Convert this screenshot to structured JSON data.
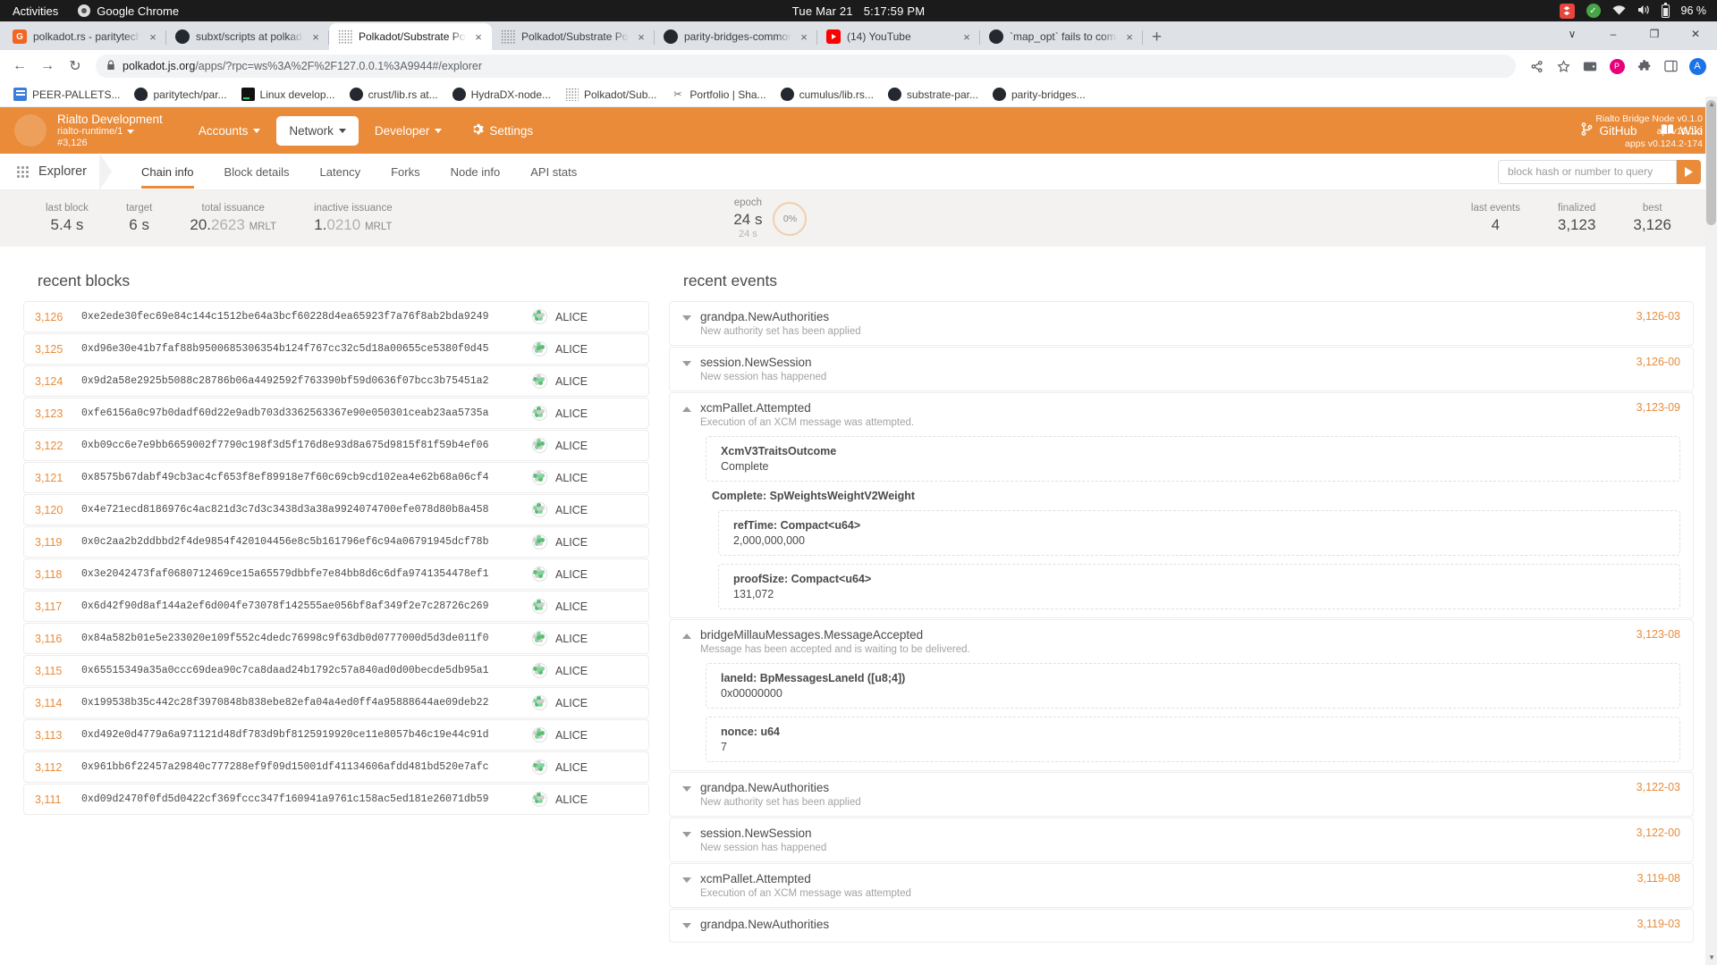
{
  "os_bar": {
    "activities": "Activities",
    "app_name": "Google Chrome",
    "clock_date": "Tue Mar 21",
    "clock_time": "5:17:59 PM",
    "battery_percent": "96 %",
    "tray_icons": [
      "dropbox-icon",
      "check-circle-icon",
      "wifi-icon",
      "volume-icon",
      "battery-icon"
    ]
  },
  "browser": {
    "tabs": [
      {
        "title": "polkadot.rs - paritytech/p",
        "favicon": "gitlab-icon",
        "active": false
      },
      {
        "title": "subxt/scripts at polkadot",
        "favicon": "github-icon",
        "active": false
      },
      {
        "title": "Polkadot/Substrate Porta",
        "favicon": "polkadot-icon",
        "active": true
      },
      {
        "title": "Polkadot/Substrate Porta",
        "favicon": "polkadot-icon",
        "active": false
      },
      {
        "title": "parity-bridges-common/x",
        "favicon": "github-icon",
        "active": false
      },
      {
        "title": "(14) YouTube",
        "favicon": "youtube-icon",
        "active": false
      },
      {
        "title": "`map_opt` fails to compil",
        "favicon": "github-icon",
        "active": false
      }
    ],
    "new_tab_label": "+",
    "close_label": "×",
    "window_controls": {
      "list": "∨",
      "minimize": "–",
      "maximize": "❐",
      "close": "✕"
    },
    "nav": {
      "back": "←",
      "forward": "→",
      "reload": "↻"
    },
    "omnibox": {
      "lock": "🔒",
      "host": "polkadot.js.org",
      "path": "/apps/?rpc=ws%3A%2F%2F127.0.0.1%3A9944#/explorer"
    },
    "toolbar_right": [
      "share-icon",
      "bookmark-star-icon",
      "wallet-icon",
      "extension-p-icon",
      "extensions-icon",
      "sidepanel-icon",
      "profile-avatar"
    ],
    "avatar_letter": "A",
    "bookmarks": [
      {
        "label": "PEER-PALLETS...",
        "icon": "blue-doc-icon"
      },
      {
        "label": "paritytech/par...",
        "icon": "github-icon"
      },
      {
        "label": "Linux develop...",
        "icon": "terminal-icon"
      },
      {
        "label": "crust/lib.rs at...",
        "icon": "github-icon"
      },
      {
        "label": "HydraDX-node...",
        "icon": "github-icon"
      },
      {
        "label": "Polkadot/Sub...",
        "icon": "polkadot-icon"
      },
      {
        "label": "Portfolio | Sha...",
        "icon": "scissors-icon"
      },
      {
        "label": "cumulus/lib.rs...",
        "icon": "github-icon"
      },
      {
        "label": "substrate-par...",
        "icon": "github-icon"
      },
      {
        "label": "parity-bridges...",
        "icon": "github-icon"
      }
    ]
  },
  "app": {
    "accent_color": "#e98b39",
    "chain": {
      "name": "Rialto Development",
      "runtime": "rialto-runtime/1",
      "block": "#3,126"
    },
    "nav": [
      {
        "label": "Accounts",
        "active": false,
        "has_caret": true
      },
      {
        "label": "Network",
        "active": true,
        "has_caret": true
      },
      {
        "label": "Developer",
        "active": false,
        "has_caret": true
      },
      {
        "label": "Settings",
        "active": false,
        "has_caret": false,
        "icon": "gear-icon"
      }
    ],
    "header_links": [
      {
        "label": "GitHub",
        "icon": "git-branch-icon"
      },
      {
        "label": "Wiki",
        "icon": "book-icon"
      }
    ],
    "version": {
      "node": "Rialto Bridge Node v0.1.0",
      "api": "api v10.1.3",
      "apps": "apps v0.124.2-174"
    },
    "subnav": {
      "section": "Explorer",
      "tabs": [
        {
          "label": "Chain info",
          "active": true
        },
        {
          "label": "Block details",
          "active": false
        },
        {
          "label": "Latency",
          "active": false
        },
        {
          "label": "Forks",
          "active": false
        },
        {
          "label": "Node info",
          "active": false
        },
        {
          "label": "API stats",
          "active": false
        }
      ],
      "search_placeholder": "block hash or number to query",
      "search_value": "",
      "search_go_icon": "play-icon"
    },
    "stats": {
      "left": [
        {
          "label": "last block",
          "value": "5.4 s"
        },
        {
          "label": "target",
          "value": "6 s"
        },
        {
          "label": "total issuance",
          "value_bold": "20.",
          "value_dim": "2623",
          "unit": "MRLT"
        },
        {
          "label": "inactive issuance",
          "value_bold": "1.",
          "value_dim": "0210",
          "unit": "MRLT"
        }
      ],
      "epoch": {
        "label": "epoch",
        "value": "24 s",
        "sub": "24 s",
        "ring_percent": "0%"
      },
      "right": [
        {
          "label": "last events",
          "value": "4"
        },
        {
          "label": "finalized",
          "value": "3,123"
        },
        {
          "label": "best",
          "value": "3,126"
        }
      ]
    },
    "recent_blocks": {
      "title": "recent blocks",
      "rows": [
        {
          "number": "3,126",
          "hash": "0xe2ede30fec69e84c144c1512be64a3bcf60228d4ea65923f7a76f8ab2bda9249",
          "author": "ALICE"
        },
        {
          "number": "3,125",
          "hash": "0xd96e30e41b7faf88b9500685306354b124f767cc32c5d18a00655ce5380f0d45",
          "author": "ALICE"
        },
        {
          "number": "3,124",
          "hash": "0x9d2a58e2925b5088c28786b06a4492592f763390bf59d0636f07bcc3b75451a2",
          "author": "ALICE"
        },
        {
          "number": "3,123",
          "hash": "0xfe6156a0c97b0dadf60d22e9adb703d3362563367e90e050301ceab23aa5735a",
          "author": "ALICE"
        },
        {
          "number": "3,122",
          "hash": "0xb09cc6e7e9bb6659002f7790c198f3d5f176d8e93d8a675d9815f81f59b4ef06",
          "author": "ALICE"
        },
        {
          "number": "3,121",
          "hash": "0x8575b67dabf49cb3ac4cf653f8ef89918e7f60c69cb9cd102ea4e62b68a06cf4",
          "author": "ALICE"
        },
        {
          "number": "3,120",
          "hash": "0x4e721ecd8186976c4ac821d3c7d3c3438d3a38a9924074700efe078d80b8a458",
          "author": "ALICE"
        },
        {
          "number": "3,119",
          "hash": "0x0c2aa2b2ddbbd2f4de9854f420104456e8c5b161796ef6c94a06791945dcf78b",
          "author": "ALICE"
        },
        {
          "number": "3,118",
          "hash": "0x3e2042473faf0680712469ce15a65579dbbfe7e84bb8d6c6dfa9741354478ef1",
          "author": "ALICE"
        },
        {
          "number": "3,117",
          "hash": "0x6d42f90d8af144a2ef6d004fe73078f142555ae056bf8af349f2e7c28726c269",
          "author": "ALICE"
        },
        {
          "number": "3,116",
          "hash": "0x84a582b01e5e233020e109f552c4dedc76998c9f63db0d0777000d5d3de011f0",
          "author": "ALICE"
        },
        {
          "number": "3,115",
          "hash": "0x65515349a35a0ccc69dea90c7ca8daad24b1792c57a840ad0d00becde5db95a1",
          "author": "ALICE"
        },
        {
          "number": "3,114",
          "hash": "0x199538b35c442c28f3970848b838ebe82efa04a4ed0ff4a95888644ae09deb22",
          "author": "ALICE"
        },
        {
          "number": "3,113",
          "hash": "0xd492e0d4779a6a971121d48df783d9bf8125919920ce11e8057b46c19e44c91d",
          "author": "ALICE"
        },
        {
          "number": "3,112",
          "hash": "0x961bb6f22457a29840c777288ef9f09d15001df41134606afdd481bd520e7afc",
          "author": "ALICE"
        },
        {
          "number": "3,111",
          "hash": "0xd09d2470f0fd5d0422cf369fccc347f160941a9761c158ac5ed181e26071db59",
          "author": "ALICE"
        }
      ]
    },
    "recent_events": {
      "title": "recent events",
      "items": [
        {
          "name": "grandpa.NewAuthorities",
          "desc": "New authority set has been applied",
          "tag": "3,126-03",
          "expanded": false,
          "details": []
        },
        {
          "name": "session.NewSession",
          "desc": "New session has happened",
          "tag": "3,126-00",
          "expanded": false,
          "details": []
        },
        {
          "name": "xcmPallet.Attempted",
          "desc": "Execution of an XCM message was attempted.",
          "tag": "3,123-09",
          "expanded": true,
          "details": [
            {
              "key": "XcmV3TraitsOutcome",
              "value": "Complete",
              "nested": false
            },
            {
              "sub_label": "Complete: SpWeightsWeightV2Weight"
            },
            {
              "key": "refTime: Compact<u64>",
              "value": "2,000,000,000",
              "nested": true
            },
            {
              "key": "proofSize: Compact<u64>",
              "value": "131,072",
              "nested": true
            }
          ]
        },
        {
          "name": "bridgeMillauMessages.MessageAccepted",
          "desc": "Message has been accepted and is waiting to be delivered.",
          "tag": "3,123-08",
          "expanded": true,
          "details": [
            {
              "key": "laneId: BpMessagesLaneId ([u8;4])",
              "value": "0x00000000",
              "nested": false
            },
            {
              "key": "nonce: u64",
              "value": "7",
              "nested": false
            }
          ]
        },
        {
          "name": "grandpa.NewAuthorities",
          "desc": "New authority set has been applied",
          "tag": "3,122-03",
          "expanded": false,
          "details": []
        },
        {
          "name": "session.NewSession",
          "desc": "New session has happened",
          "tag": "3,122-00",
          "expanded": false,
          "details": []
        },
        {
          "name": "xcmPallet.Attempted",
          "desc": "Execution of an XCM message was attempted",
          "tag": "3,119-08",
          "expanded": false,
          "details": []
        },
        {
          "name": "grandpa.NewAuthorities",
          "desc": "",
          "tag": "3,119-03",
          "expanded": false,
          "details": []
        }
      ]
    }
  }
}
